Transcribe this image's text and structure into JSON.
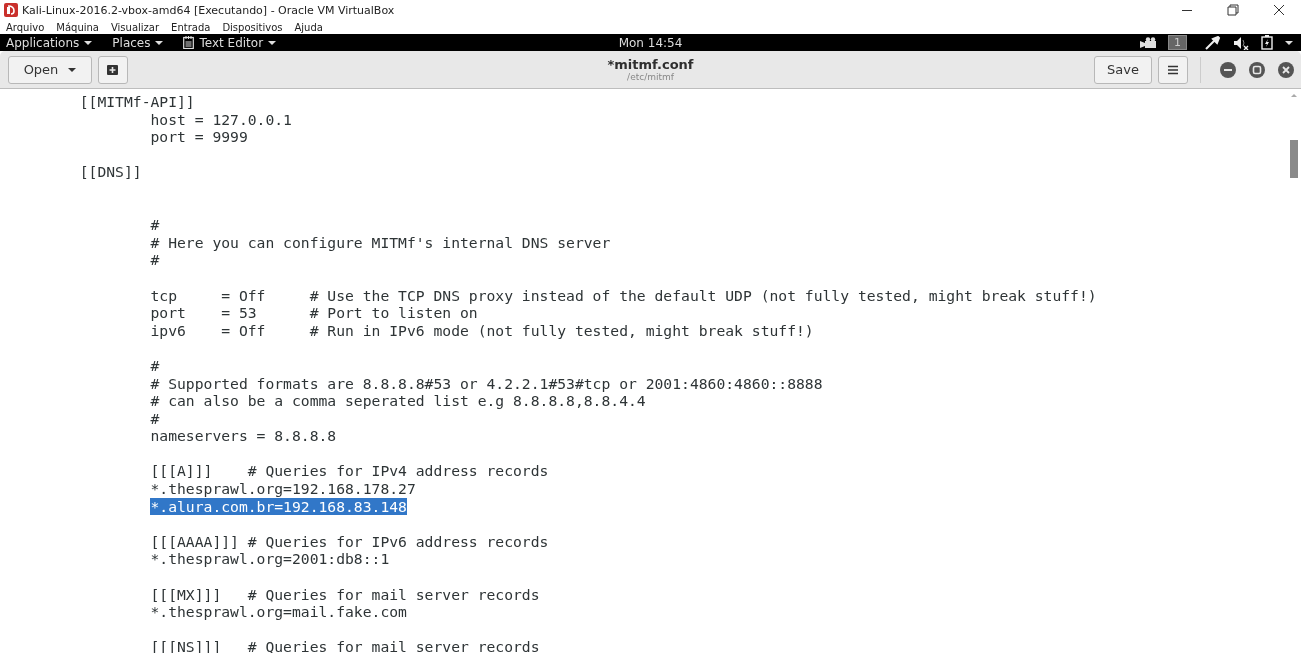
{
  "host_window": {
    "title": "Kali-Linux-2016.2-vbox-amd64 [Executando] - Oracle VM VirtualBox"
  },
  "menu_bar": [
    "Arquivo",
    "Máquina",
    "Visualizar",
    "Entrada",
    "Dispositivos",
    "Ajuda"
  ],
  "top_bar": {
    "menus": [
      {
        "label": "Applications",
        "kind": "plain"
      },
      {
        "label": "Places",
        "kind": "plain"
      },
      {
        "label": "Text Editor",
        "kind": "app"
      }
    ],
    "clock": "Mon 14:54",
    "workspace": "1"
  },
  "header_bar": {
    "open_button": "Open",
    "title": "*mitmf.conf",
    "subtitle": "/etc/mitmf",
    "save_button": "Save"
  },
  "editor": {
    "lines": [
      {
        "kind": "code",
        "text": "\t[[MITMf-API]]",
        "selected": false
      },
      {
        "kind": "code",
        "text": "\t\thost = 127.0.0.1",
        "selected": false
      },
      {
        "kind": "code",
        "text": "\t\tport = 9999",
        "selected": false
      },
      {
        "kind": "blank"
      },
      {
        "kind": "code",
        "text": "\t[[DNS]]",
        "selected": false
      },
      {
        "kind": "blank"
      },
      {
        "kind": "blank"
      },
      {
        "kind": "code",
        "text": "\t\t#",
        "selected": false
      },
      {
        "kind": "code",
        "text": "\t\t# Here you can configure MITMf's internal DNS server",
        "selected": false
      },
      {
        "kind": "code",
        "text": "\t\t#",
        "selected": false
      },
      {
        "kind": "blank"
      },
      {
        "kind": "code",
        "text": "\t\ttcp     = Off     # Use the TCP DNS proxy instead of the default UDP (not fully tested, might break stuff!)",
        "selected": false
      },
      {
        "kind": "code",
        "text": "\t\tport    = 53      # Port to listen on",
        "selected": false
      },
      {
        "kind": "code",
        "text": "\t\tipv6    = Off     # Run in IPv6 mode (not fully tested, might break stuff!)",
        "selected": false
      },
      {
        "kind": "blank"
      },
      {
        "kind": "code",
        "text": "\t\t#",
        "selected": false
      },
      {
        "kind": "code",
        "text": "\t\t# Supported formats are 8.8.8.8#53 or 4.2.2.1#53#tcp or 2001:4860:4860::8888",
        "selected": false
      },
      {
        "kind": "code",
        "text": "\t\t# can also be a comma seperated list e.g 8.8.8.8,8.8.4.4",
        "selected": false
      },
      {
        "kind": "code",
        "text": "\t\t#",
        "selected": false
      },
      {
        "kind": "code",
        "text": "\t\tnameservers = 8.8.8.8",
        "selected": false
      },
      {
        "kind": "blank"
      },
      {
        "kind": "code",
        "text": "\t\t[[[A]]]    # Queries for IPv4 address records",
        "selected": false
      },
      {
        "kind": "code",
        "text": "\t\t*.thesprawl.org=192.168.178.27",
        "selected": false
      },
      {
        "kind": "code",
        "text": "\t\t*.alura.com.br=192.168.83.148",
        "selected": true
      },
      {
        "kind": "blank"
      },
      {
        "kind": "code",
        "text": "\t\t[[[AAAA]]] # Queries for IPv6 address records",
        "selected": false
      },
      {
        "kind": "code",
        "text": "\t\t*.thesprawl.org=2001:db8::1",
        "selected": false
      },
      {
        "kind": "blank"
      },
      {
        "kind": "code",
        "text": "\t\t[[[MX]]]   # Queries for mail server records",
        "selected": false
      },
      {
        "kind": "code",
        "text": "\t\t*.thesprawl.org=mail.fake.com",
        "selected": false
      },
      {
        "kind": "blank"
      },
      {
        "kind": "code",
        "text": "\t\t[[[NS]]]   # Queries for mail server records",
        "selected": false
      }
    ]
  }
}
